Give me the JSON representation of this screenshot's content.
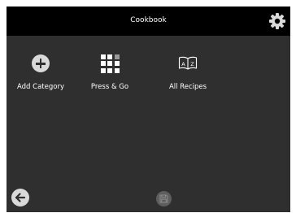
{
  "header": {
    "title": "Cookbook",
    "settings_icon": "gear-icon"
  },
  "tiles": [
    {
      "label": "Add Category",
      "icon": "plus-circle-icon"
    },
    {
      "label": "Press & Go",
      "icon": "grid-icon"
    },
    {
      "label": "All Recipes",
      "icon": "open-book-az-icon"
    }
  ],
  "footer": {
    "back_icon": "arrow-left-icon",
    "save_icon": "floppy-disk-icon",
    "save_enabled": false
  },
  "colors": {
    "background": "#2f2f2f",
    "header_bg": "#000000",
    "text": "#ffffff",
    "icon_light": "#d9d9d9",
    "disabled": "#5e5e5e"
  }
}
